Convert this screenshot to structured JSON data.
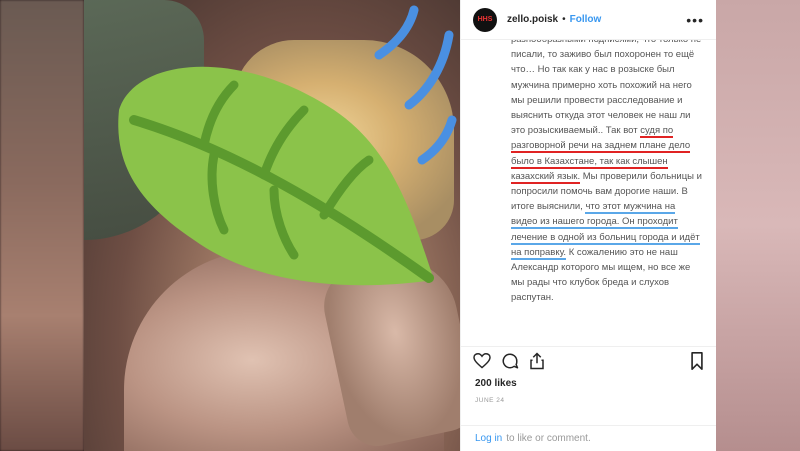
{
  "post": {
    "username": "zello.poisk",
    "avatar_text": "HHS",
    "dot": "•",
    "follow_label": "Follow",
    "more_label": "•••",
    "caption": {
      "part1": "разнообразными подписями, что только не писали, то заживо был похоронен то ещё что… Но так как у нас в розыске был мужчина примерно хоть похожий на него мы решили провести расследование и выяснить откуда этот человек не наш ли это розыскиваемый.. Так вот ",
      "red_underline": "судя по разговорной речи на заднем плане дело было в Казахстане, так как слышен казахский язык.",
      "part2": " Мы проверили больницы и попросили помочь вам дорогие наши. В итоге выяснили, ",
      "blue_underline": "что этот мужчина на видео из нашего города. Он проходит лечение в одной из больниц города и идёт на поправку.",
      "part3": " К сожалению это не наш Александр которого мы ищем, но все же мы рады что клубок бреда и слухов распутан."
    },
    "likes": "200 likes",
    "date": "JUNE 24",
    "login_label": "Log in",
    "login_suffix": "to like or comment."
  },
  "icons": {
    "like": "heart-icon",
    "comment": "comment-icon",
    "share": "share-icon",
    "save": "bookmark-icon"
  },
  "colors": {
    "accent": "#3897f0",
    "red_underline": "#e02323",
    "blue_underline": "#5aa7e8",
    "leaf": "#8bc34a"
  }
}
